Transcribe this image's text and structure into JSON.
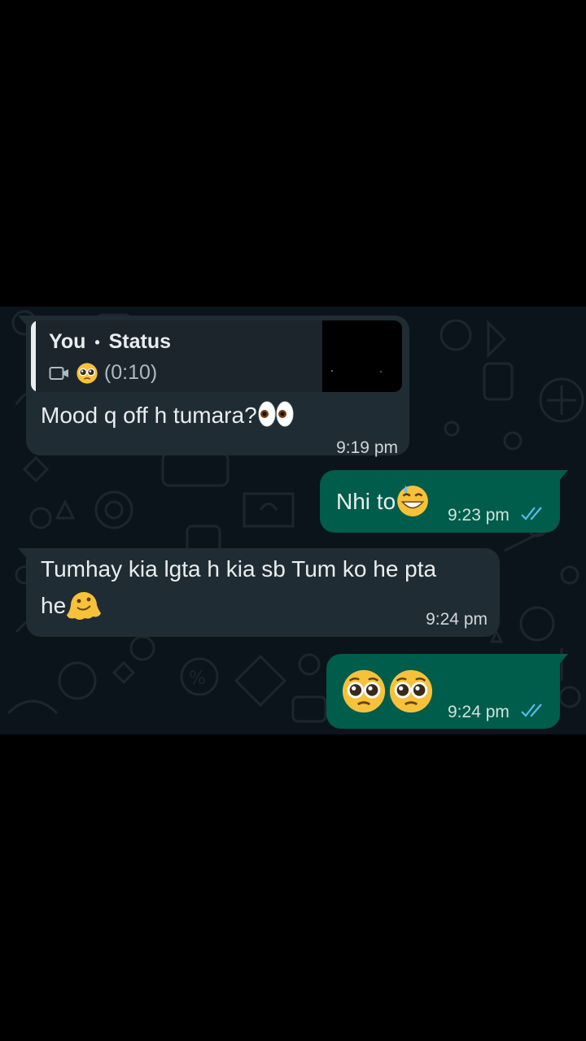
{
  "messages": [
    {
      "direction": "incoming",
      "quote": {
        "author": "You",
        "separator": "•",
        "source": "Status",
        "duration": "(0:10)",
        "media_icon": "video-camera-icon",
        "emoji": "pleading-face"
      },
      "text": "Mood q off h tumara?",
      "emoji": "eyes",
      "time": "9:19 pm"
    },
    {
      "direction": "outgoing",
      "text": "Nhi to",
      "emoji": "grinning-face-with-sweat",
      "time": "9:23 pm",
      "status": "read"
    },
    {
      "direction": "incoming",
      "text_line1": "Tumhay kia lgta h kia sb Tum ko he pta",
      "text_line2": "he",
      "emoji": "melting-face",
      "time": "9:24 pm"
    },
    {
      "direction": "outgoing",
      "emoji": [
        "pleading-face",
        "pleading-face"
      ],
      "time": "9:24 pm",
      "status": "read"
    }
  ],
  "colors": {
    "chat_bg": "#0b141a",
    "incoming_bubble": "#202c33",
    "outgoing_bubble": "#005c4b",
    "read_tick": "#53bdeb"
  }
}
